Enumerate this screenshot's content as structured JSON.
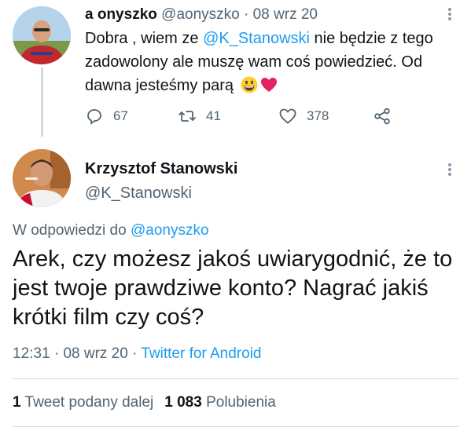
{
  "tweet1": {
    "display_name": "a onyszko",
    "handle": "@aonyszko",
    "separator": "·",
    "date": "08 wrz 20",
    "text_before_mention": "Dobra , wiem ze ",
    "mention": "@K_Stanowski",
    "text_after_mention": " nie będzie z tego zadowolony ale muszę wam coś powiedzieć. Od dawna jesteśmy parą",
    "emojis": [
      "grinning-face-emoji",
      "red-heart-emoji"
    ],
    "actions": {
      "replies": "67",
      "retweets": "41",
      "likes": "378"
    }
  },
  "tweet2": {
    "display_name": "Krzysztof Stanowski",
    "handle": "@K_Stanowski",
    "reply_prefix": "W odpowiedzi do ",
    "reply_to": "@aonyszko",
    "text": "Arek, czy możesz jakoś uwiarygodnić, że to jest twoje prawdziwe konto? Nagrać jakiś krótki film czy coś?",
    "time": "12:31",
    "separator": "·",
    "date": "08 wrz 20",
    "separator2": "·",
    "source": "Twitter for Android",
    "stats": {
      "retweet_count": "1",
      "retweet_label": "Tweet podany dalej",
      "like_count": "1 083",
      "like_label": "Polubienia"
    }
  },
  "colors": {
    "text": "#0f1419",
    "secondary": "#536471",
    "link": "#1d9bf0",
    "border": "#cfd9de"
  }
}
